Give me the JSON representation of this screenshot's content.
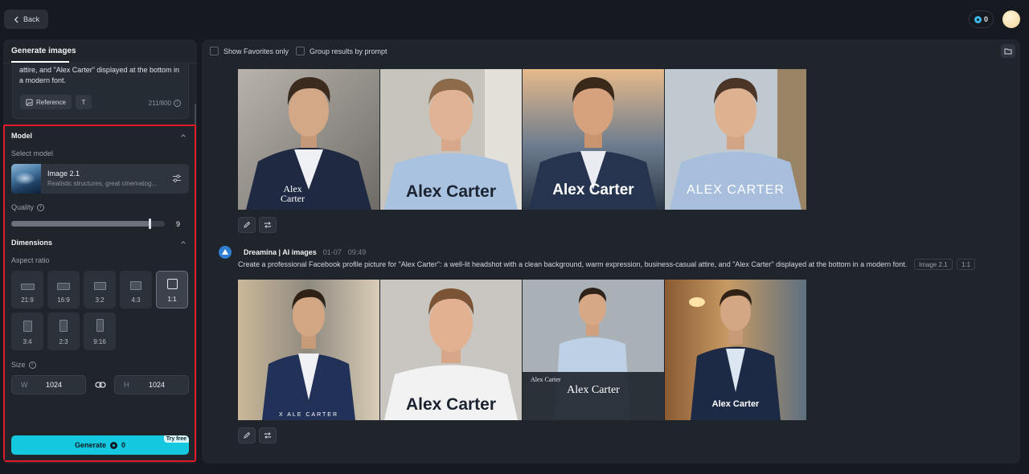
{
  "header": {
    "back_label": "Back",
    "credits": "0"
  },
  "left_panel": {
    "tab_label": "Generate images",
    "prompt_visible_text": "attire, and \"Alex Carter\" displayed at the bottom in a modern font.",
    "reference_label": "Reference",
    "text_btn_label": "T",
    "char_count": "211/800",
    "model_section": {
      "title": "Model",
      "select_label": "Select model",
      "model_name": "Image 2.1",
      "model_desc": "Realistic structures, great cinematog..."
    },
    "quality": {
      "label": "Quality",
      "value": "9",
      "fraction": 0.9
    },
    "dimensions": {
      "title": "Dimensions",
      "aspect_label": "Aspect ratio",
      "ratios": [
        "21:9",
        "16:9",
        "3:2",
        "4:3",
        "1:1",
        "3:4",
        "2:3",
        "9:16"
      ],
      "selected_ratio": "1:1",
      "size_label": "Size",
      "width_prefix": "W",
      "width": "1024",
      "height_prefix": "H",
      "height": "1024"
    },
    "generate": {
      "label": "Generate",
      "cost": "0",
      "badge": "Try free"
    }
  },
  "main": {
    "show_favorites": "Show Favorites only",
    "group_results": "Group results by prompt",
    "group1": {
      "captions": [
        "Alex\nCarter",
        "Alex Carter",
        "Alex Carter",
        "ALEX CARTER"
      ]
    },
    "group2": {
      "author": "Dreamina | AI images",
      "date": "01-07",
      "time": "09:49",
      "prompt": "Create a professional Facebook profile picture for \"Alex Carter\": a well-lit headshot with a clean background, warm expression, business-casual attire, and \"Alex Carter\" displayed at the bottom in a modern font.",
      "tag_model": "Image 2.1",
      "tag_ratio": "1:1",
      "captions": [
        "X ALE CARTER",
        "Alex Carter",
        "Alex Carter",
        "Alex Carter"
      ],
      "caption_extra": "Alex Carter"
    }
  },
  "colors": {
    "accent": "#14c8e0",
    "highlight_border": "#e21b2b",
    "panel_bg": "#20252c",
    "page_bg": "#161a20"
  }
}
